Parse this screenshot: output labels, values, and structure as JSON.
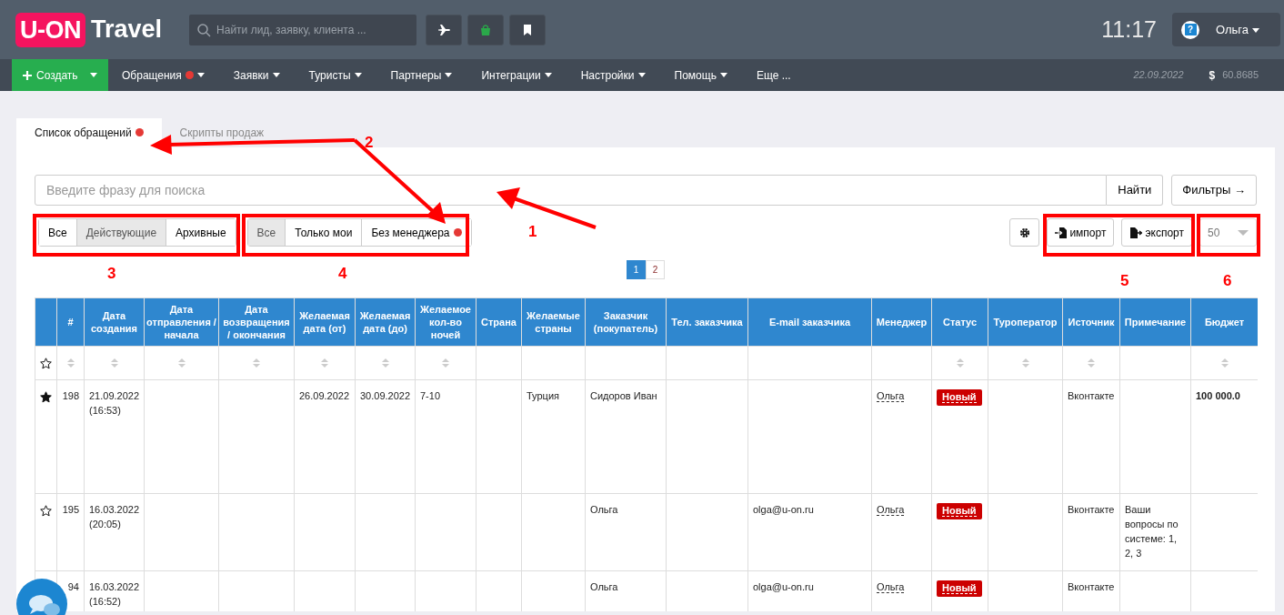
{
  "header": {
    "logo": {
      "mark": "U-ON",
      "word": "Travel"
    },
    "search": {
      "placeholder": "Найти лид, заявку, клиента ..."
    },
    "time": "11:17",
    "user": {
      "help_glyph": "?",
      "name": "Ольга"
    }
  },
  "nav": {
    "create": {
      "label": "Создать"
    },
    "items": [
      {
        "label": "Обращения",
        "dot": true,
        "dropdown": true
      },
      {
        "label": "Заявки",
        "dot": false,
        "dropdown": true
      },
      {
        "label": "Туристы",
        "dot": false,
        "dropdown": true
      },
      {
        "label": "Партнеры",
        "dot": false,
        "dropdown": true
      },
      {
        "label": "Интеграции",
        "dot": false,
        "dropdown": true
      },
      {
        "label": "Настройки",
        "dot": false,
        "dropdown": true
      },
      {
        "label": "Помощь",
        "dot": false,
        "dropdown": true
      },
      {
        "label": "Еще ...",
        "dot": false,
        "dropdown": false
      }
    ],
    "date": "22.09.2022",
    "currency": "$",
    "rate": "60.8685"
  },
  "tabs": [
    {
      "label": "Список обращений",
      "dot": true,
      "selected": true
    },
    {
      "label": "Скрипты продаж",
      "dot": false,
      "selected": false
    }
  ],
  "search": {
    "placeholder": "Введите фразу для поиска",
    "button": "Найти",
    "filters_button": "Фильтры →"
  },
  "filter_groups": [
    [
      {
        "label": "Все",
        "dot": false,
        "selected": false
      },
      {
        "label": "Действующие",
        "dot": false,
        "selected": true
      },
      {
        "label": "Архивные",
        "dot": false,
        "selected": false
      }
    ],
    [
      {
        "label": "Все",
        "dot": false,
        "selected": true
      },
      {
        "label": "Только мои",
        "dot": false,
        "selected": false
      },
      {
        "label": "Без менеджера",
        "dot": true,
        "selected": false
      }
    ]
  ],
  "toolbar": {
    "import": "импорт",
    "export": "экспорт",
    "page_size": "50"
  },
  "pagination": [
    {
      "label": "1",
      "selected": true
    },
    {
      "label": "2",
      "selected": false
    }
  ],
  "table": {
    "columns": [
      {
        "label": "#",
        "sortable": true
      },
      {
        "label": "Дата создания",
        "sortable": true
      },
      {
        "label": "Дата отправления / начала",
        "sortable": true
      },
      {
        "label": "Дата возвращения / окончания",
        "sortable": true
      },
      {
        "label": "Желаемая дата (от)",
        "sortable": true
      },
      {
        "label": "Желаемая дата (до)",
        "sortable": true
      },
      {
        "label": "Желаемое кол-во ночей",
        "sortable": true
      },
      {
        "label": "Страна",
        "sortable": false
      },
      {
        "label": "Желаемые страны",
        "sortable": false
      },
      {
        "label": "Заказчик (покупатель)",
        "sortable": false
      },
      {
        "label": "Тел. заказчика",
        "sortable": false
      },
      {
        "label": "E-mail заказчика",
        "sortable": false
      },
      {
        "label": "Менеджер",
        "sortable": false,
        "kind": "manager"
      },
      {
        "label": "Статус",
        "sortable": true,
        "kind": "status"
      },
      {
        "label": "Туроператор",
        "sortable": true
      },
      {
        "label": "Источник",
        "sortable": true
      },
      {
        "label": "Примечание",
        "sortable": false
      },
      {
        "label": "Бюджет",
        "sortable": true,
        "kind": "bold"
      }
    ],
    "rows": [
      {
        "starred": true,
        "cells": [
          "198",
          "21.09.2022 (16:53)",
          "",
          "",
          "26.09.2022",
          "30.09.2022",
          "7-10",
          "",
          "Турция",
          "Сидоров Иван",
          "",
          "",
          "Ольга",
          "Новый",
          "",
          "Вконтакте",
          "",
          "100 000.0"
        ]
      },
      {
        "starred": false,
        "cells": [
          "195",
          "16.03.2022 (20:05)",
          "",
          "",
          "",
          "",
          "",
          "",
          "",
          "Ольга",
          "",
          "olga@u-on.ru",
          "Ольга",
          "Новый",
          "",
          "Вконтакте",
          "Ваши вопросы по системе: 1, 2, 3",
          ""
        ]
      },
      {
        "cells": [
          "94",
          "16.03.2022 (16:52)",
          "",
          "",
          "",
          "",
          "",
          "",
          "",
          "Ольга",
          "",
          "olga@u-on.ru",
          "Ольга",
          "Новый",
          "",
          "Вконтакте",
          "",
          ""
        ]
      }
    ]
  },
  "annotations": [
    {
      "label": "1"
    },
    {
      "label": "2"
    },
    {
      "label": "3"
    },
    {
      "label": "4"
    },
    {
      "label": "5"
    },
    {
      "label": "6"
    }
  ]
}
